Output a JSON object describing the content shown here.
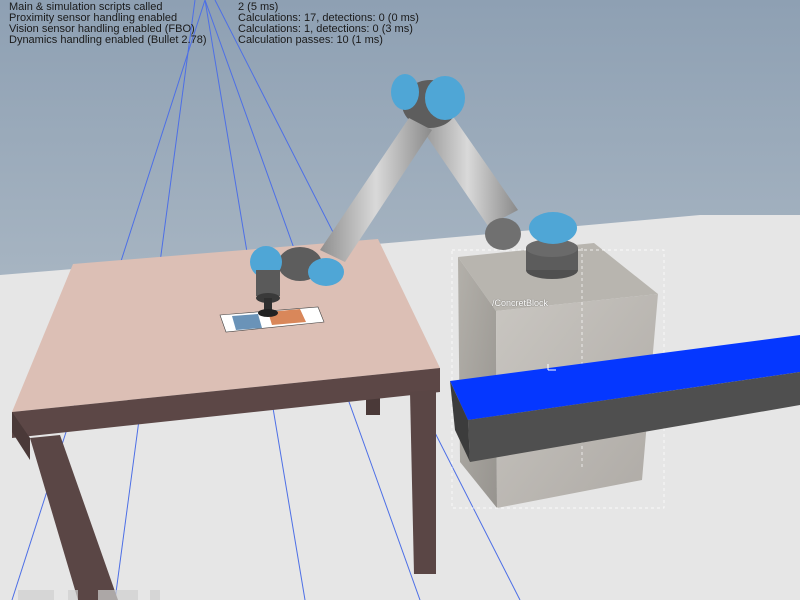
{
  "overlay": {
    "left_lines": [
      "Main & simulation scripts called",
      "Proximity sensor handling enabled",
      "Vision sensor handling enabled (FBO)",
      "Dynamics handling enabled (Bullet 2.78)"
    ],
    "right_lines": [
      "2 (5 ms)",
      "Calculations: 17, detections: 0 (0 ms)",
      "Calculations: 1, detections: 0 (3 ms)",
      "Calculation passes: 10 (1 ms)"
    ]
  },
  "scene": {
    "selected_object_label": "/ConcretBlock",
    "colors": {
      "sky_top": "#8ea0b3",
      "sky_bottom": "#c3ccd3",
      "floor": "#e6e6e6",
      "table_top": "#dcbfb5",
      "table_legs": "#5a4645",
      "robot_link": "#b5b5b5",
      "robot_joint": "#4fa6d6",
      "concrete": "#a9a7a2",
      "conveyor_top": "#0537ff",
      "conveyor_side": "#4f4f4f"
    }
  }
}
